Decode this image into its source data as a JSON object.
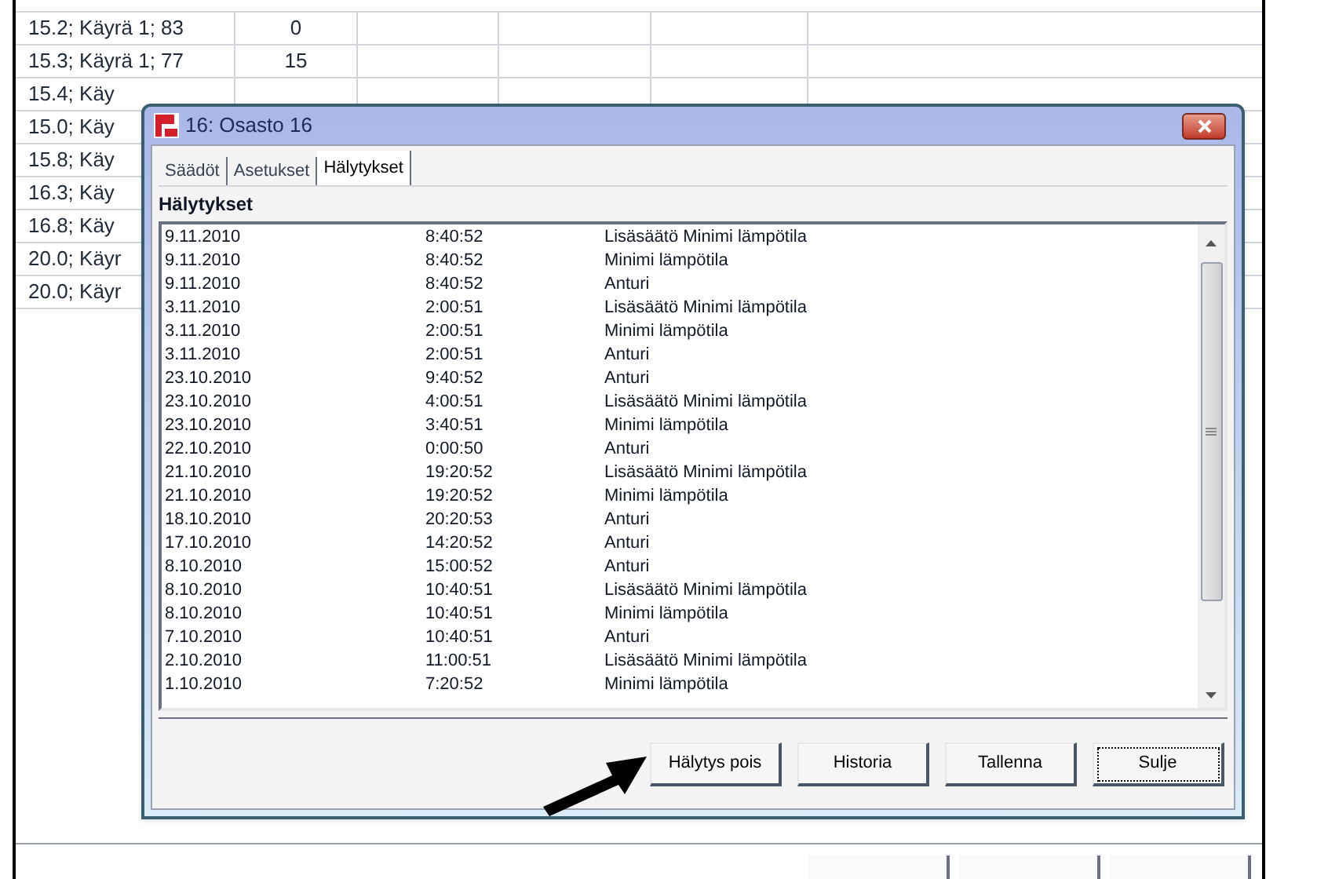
{
  "background_table": {
    "rows": [
      {
        "column_1": "15.2; Käyrä 1; 83",
        "column_2": "0"
      },
      {
        "column_1": "15.3; Käyrä 1; 77",
        "column_2": "15"
      },
      {
        "column_1": "15.4; Käy"
      },
      {
        "column_1": "15.0; Käy"
      },
      {
        "column_1": "15.8; Käy"
      },
      {
        "column_1": "16.3; Käy"
      },
      {
        "column_1": "16.8; Käy"
      },
      {
        "column_1": "20.0; Käyr"
      },
      {
        "column_1": "20.0; Käyr"
      }
    ]
  },
  "dialog": {
    "title": "16: Osasto 16",
    "tabs": [
      {
        "label": "Säädöt",
        "selected": false
      },
      {
        "label": "Asetukset",
        "selected": false
      },
      {
        "label": "Hälytykset",
        "selected": true
      }
    ],
    "section_title": "Hälytykset",
    "alarms": [
      {
        "date": "9.11.2010",
        "time": "8:40:52",
        "message": "Lisäsäätö Minimi lämpötila"
      },
      {
        "date": "9.11.2010",
        "time": "8:40:52",
        "message": "Minimi lämpötila"
      },
      {
        "date": "9.11.2010",
        "time": "8:40:52",
        "message": "Anturi"
      },
      {
        "date": "3.11.2010",
        "time": "2:00:51",
        "message": "Lisäsäätö Minimi lämpötila"
      },
      {
        "date": "3.11.2010",
        "time": "2:00:51",
        "message": "Minimi lämpötila"
      },
      {
        "date": "3.11.2010",
        "time": "2:00:51",
        "message": "Anturi"
      },
      {
        "date": "23.10.2010",
        "time": "9:40:52",
        "message": "Anturi"
      },
      {
        "date": "23.10.2010",
        "time": "4:00:51",
        "message": "Lisäsäätö Minimi lämpötila"
      },
      {
        "date": "23.10.2010",
        "time": "3:40:51",
        "message": "Minimi lämpötila"
      },
      {
        "date": "22.10.2010",
        "time": "0:00:50",
        "message": "Anturi"
      },
      {
        "date": "21.10.2010",
        "time": "19:20:52",
        "message": "Lisäsäätö Minimi lämpötila"
      },
      {
        "date": "21.10.2010",
        "time": "19:20:52",
        "message": "Minimi lämpötila"
      },
      {
        "date": "18.10.2010",
        "time": "20:20:53",
        "message": "Anturi"
      },
      {
        "date": "17.10.2010",
        "time": "14:20:52",
        "message": "Anturi"
      },
      {
        "date": "8.10.2010",
        "time": "15:00:52",
        "message": "Anturi"
      },
      {
        "date": "8.10.2010",
        "time": "10:40:51",
        "message": "Lisäsäätö Minimi lämpötila"
      },
      {
        "date": "8.10.2010",
        "time": "10:40:51",
        "message": "Minimi lämpötila"
      },
      {
        "date": "7.10.2010",
        "time": "10:40:51",
        "message": "Anturi"
      },
      {
        "date": "2.10.2010",
        "time": "11:00:51",
        "message": "Lisäsäätö Minimi lämpötila"
      },
      {
        "date": "1.10.2010",
        "time": "7:20:52",
        "message": "Minimi lämpötila"
      }
    ],
    "buttons": [
      {
        "label": "Hälytys pois",
        "focused": false
      },
      {
        "label": "Historia",
        "focused": false
      },
      {
        "label": "Tallenna",
        "focused": false
      },
      {
        "label": "Sulje",
        "focused": true
      }
    ]
  }
}
